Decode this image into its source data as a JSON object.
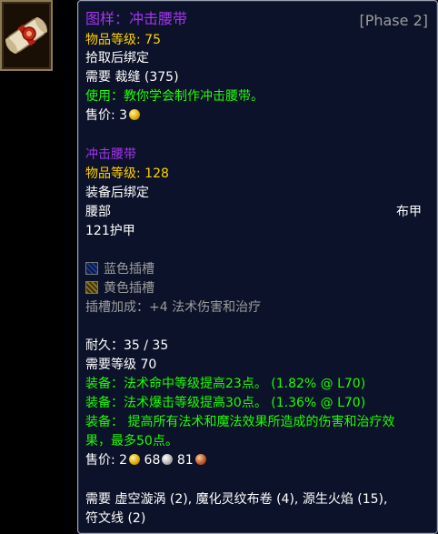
{
  "item": {
    "icon": "scroll-icon",
    "name": "图样：冲击腰带",
    "phase": "[Phase 2]",
    "ilvl_label": "物品等级",
    "ilvl_value": "75",
    "bind": "拾取后绑定",
    "req_label": "需要",
    "req_value": "裁缝 (375)",
    "use_text": "使用：教你学会制作冲击腰带。",
    "sell_label": "售价:",
    "sell_value": "3"
  },
  "crafted": {
    "name": "冲击腰带",
    "ilvl_label": "物品等级",
    "ilvl_value": "128",
    "bind": "装备后绑定",
    "slot": "腰部",
    "armor_type": "布甲",
    "armor": "121护甲",
    "sockets": [
      {
        "label": "蓝色插槽",
        "color": "#1c3b8a",
        "icon": "blue-socket-icon"
      },
      {
        "label": "黄色插槽",
        "color": "#8a7420",
        "icon": "yellow-socket-icon"
      }
    ],
    "socket_bonus": "插槽加成：+4 法术伤害和治疗",
    "durability": "耐久：35 / 35",
    "req_level": "需要等级 70",
    "equip": [
      "装备：法术命中等级提高23点。 (1.82% @ L70)",
      "装备：法术爆击等级提高30点。 (1.36% @ L70)",
      "装备： 提高所有法术和魔法效果所造成的伤害和治疗效",
      "果，最多50点。"
    ],
    "sell_label": "售价:",
    "sell_gold": "2",
    "sell_silver": "68",
    "sell_copper": "81",
    "reagents_line1": "需要 虚空漩涡 (2), 魔化灵纹布卷 (4), 源生火焰 (15),",
    "reagents_line2": "符文线 (2)"
  },
  "colors": {
    "epic": "#a335ee",
    "yellow": "#ffd100",
    "green": "#1eff00",
    "gray": "#9d9d9d",
    "background": "#0c1229"
  }
}
